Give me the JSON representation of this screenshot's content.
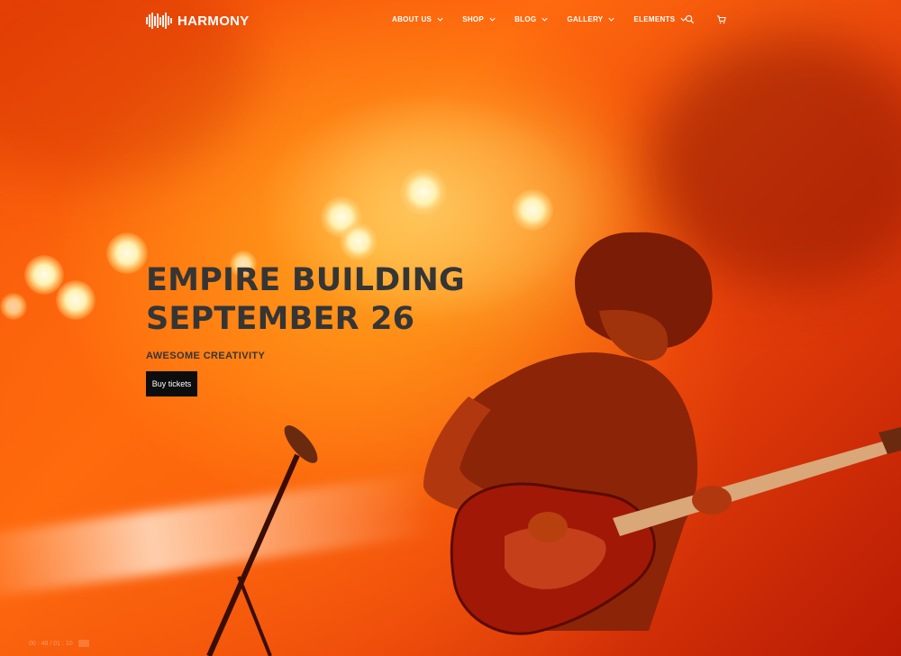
{
  "brand": {
    "name": "HARMONY",
    "logo_icon": "sound-wave-icon"
  },
  "nav": {
    "items": [
      {
        "label": "ABOUT US"
      },
      {
        "label": "SHOP"
      },
      {
        "label": "BLOG"
      },
      {
        "label": "GALLERY"
      },
      {
        "label": "ELEMENTS"
      }
    ],
    "search_icon": "search-icon",
    "cart_icon": "cart-icon"
  },
  "hero": {
    "title_line1": "EMPIRE BUILDING",
    "title_line2": "SEPTEMBER 26",
    "subtitle": "AWESOME CREATIVITY",
    "cta_label": "Buy tickets"
  },
  "video": {
    "time": "00 : 48 / 01 : 10"
  },
  "colors": {
    "text_dark": "#353535",
    "button_bg": "#0d0d0d",
    "nav_text": "#ffffff",
    "background_orange": "#ff6a0e"
  }
}
